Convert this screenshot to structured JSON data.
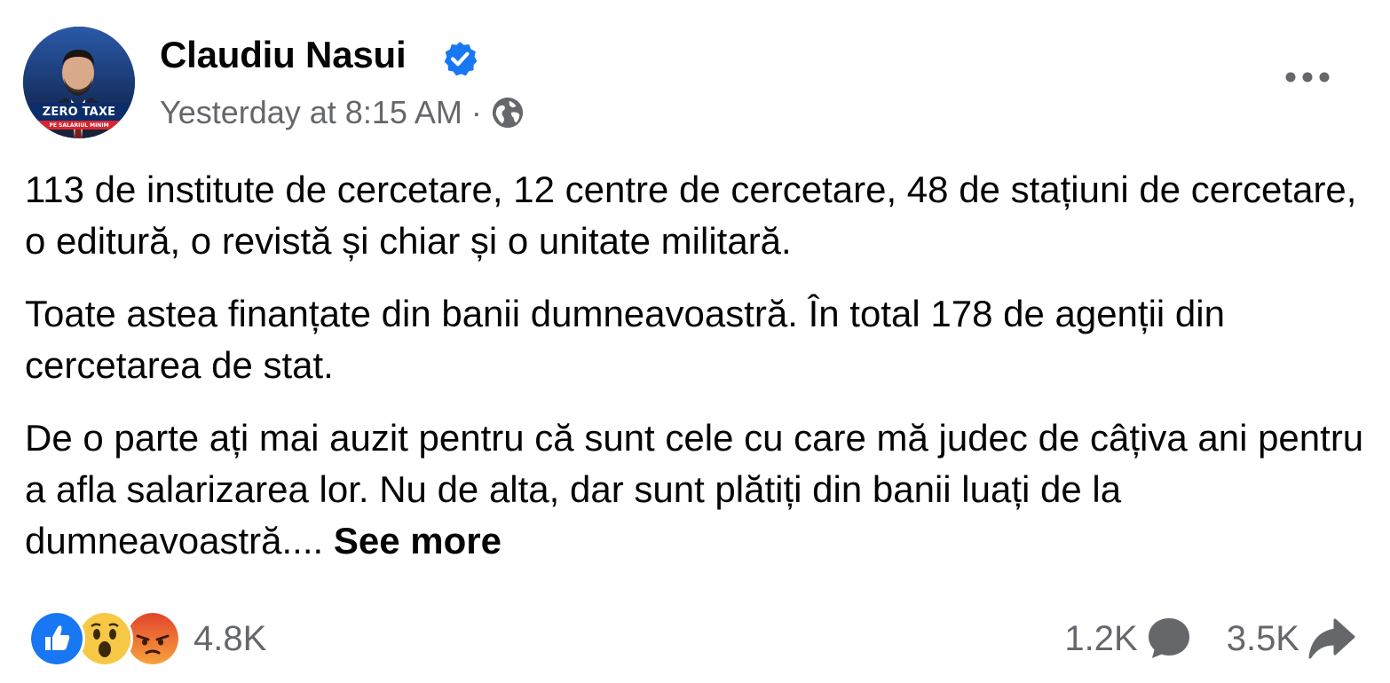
{
  "post": {
    "author": "Claudiu Nasui",
    "avatar_text": {
      "line1": "ZERO TAXE",
      "line2": "PE SALARIUL MINIM"
    },
    "timestamp": "Yesterday at 8:15 AM",
    "separator": "·",
    "paragraphs": [
      "113 de institute de cercetare, 12 centre de cercetare, 48 de stațiuni de cercetare, o editură, o revistă și chiar și o unitate militară.",
      "Toate astea finanțate din banii dumneavoastră. În total 178 de agenții din cercetarea de stat.",
      "De o parte ați mai auzit pentru că sunt cele cu care mă judec de câțiva ani pentru a afla salarizarea lor. Nu de alta, dar sunt plătiți din banii luați de la dumneavoastră.... "
    ],
    "see_more": "See more",
    "reactions": {
      "types": [
        "like-icon",
        "wow-icon",
        "angry-icon"
      ],
      "count": "4.8K"
    },
    "comments_count": "1.2K",
    "shares_count": "3.5K"
  },
  "colors": {
    "secondary_text": "#65676b",
    "verified_blue": "#1877f2",
    "like_blue": "#1877f2",
    "wow_yellow": "#f7c845",
    "angry_orange": "#f06a3c"
  }
}
